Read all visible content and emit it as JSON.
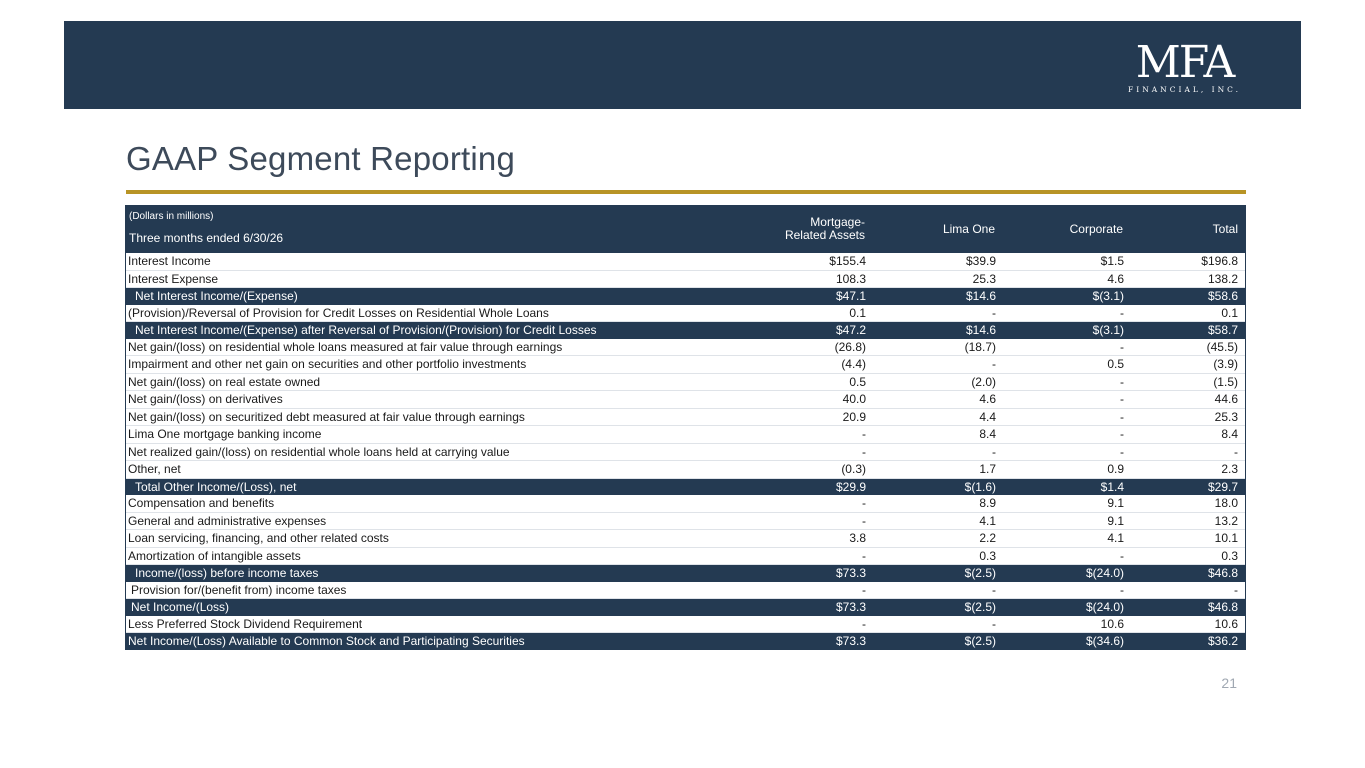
{
  "header": {
    "logo_mark": "MFA",
    "logo_sub": "FINANCIAL, INC."
  },
  "page": {
    "title": "GAAP Segment Reporting",
    "page_number": "21"
  },
  "table": {
    "units_note": "(Dollars in millions)",
    "period": "Three months ended 6/30/26",
    "columns": [
      "Mortgage-\nRelated Assets",
      "Lima One",
      "Corporate",
      "Total"
    ],
    "rows": [
      {
        "label": "Interest Income",
        "values": [
          "$155.4",
          "$39.9",
          "$1.5",
          "$196.8"
        ],
        "type": "row"
      },
      {
        "label": "Interest Expense",
        "values": [
          "108.3",
          "25.3",
          "4.6",
          "138.2"
        ],
        "type": "row"
      },
      {
        "label": "Net Interest Income/(Expense)",
        "values": [
          "$47.1",
          "$14.6",
          "$(3.1)",
          "$58.6"
        ],
        "type": "sub"
      },
      {
        "label": "(Provision)/Reversal of Provision for Credit Losses on Residential Whole Loans",
        "values": [
          "0.1",
          "-",
          "-",
          "0.1"
        ],
        "type": "row"
      },
      {
        "label": "Net Interest Income/(Expense) after Reversal of Provision/(Provision) for Credit Losses",
        "values": [
          "$47.2",
          "$14.6",
          "$(3.1)",
          "$58.7"
        ],
        "type": "sub"
      },
      {
        "label": "Net gain/(loss) on residential whole loans measured at fair value through earnings",
        "values": [
          "(26.8)",
          "(18.7)",
          "-",
          "(45.5)"
        ],
        "type": "row"
      },
      {
        "label": "Impairment and other net gain on securities and other portfolio investments",
        "values": [
          "(4.4)",
          "-",
          "0.5",
          "(3.9)"
        ],
        "type": "row"
      },
      {
        "label": "Net gain/(loss) on real estate owned",
        "values": [
          "0.5",
          "(2.0)",
          "-",
          "(1.5)"
        ],
        "type": "row"
      },
      {
        "label": "Net gain/(loss) on derivatives",
        "values": [
          "40.0",
          "4.6",
          "-",
          "44.6"
        ],
        "type": "row"
      },
      {
        "label": "Net gain/(loss) on securitized debt measured at fair value through earnings",
        "values": [
          "20.9",
          "4.4",
          "-",
          "25.3"
        ],
        "type": "row"
      },
      {
        "label": "Lima One mortgage banking income",
        "values": [
          "-",
          "8.4",
          "-",
          "8.4"
        ],
        "type": "row"
      },
      {
        "label": "Net realized gain/(loss) on residential whole loans held at carrying value",
        "values": [
          "-",
          "-",
          "-",
          "-"
        ],
        "type": "row"
      },
      {
        "label": "Other, net",
        "values": [
          "(0.3)",
          "1.7",
          "0.9",
          "2.3"
        ],
        "type": "row"
      },
      {
        "label": "Total Other Income/(Loss), net",
        "values": [
          "$29.9",
          "$(1.6)",
          "$1.4",
          "$29.7"
        ],
        "type": "sub"
      },
      {
        "label": "Compensation and benefits",
        "values": [
          "-",
          "8.9",
          "9.1",
          "18.0"
        ],
        "type": "row"
      },
      {
        "label": "General and administrative expenses",
        "values": [
          "-",
          "4.1",
          "9.1",
          "13.2"
        ],
        "type": "row"
      },
      {
        "label": "Loan servicing, financing, and other related costs",
        "values": [
          "3.8",
          "2.2",
          "4.1",
          "10.1"
        ],
        "type": "row"
      },
      {
        "label": "Amortization of intangible assets",
        "values": [
          "-",
          "0.3",
          "-",
          "0.3"
        ],
        "type": "row"
      },
      {
        "label": "Income/(loss) before income taxes",
        "values": [
          "$73.3",
          "$(2.5)",
          "$(24.0)",
          "$46.8"
        ],
        "type": "sub"
      },
      {
        "label": "Provision for/(benefit from) income taxes",
        "values": [
          "-",
          "-",
          "-",
          "-"
        ],
        "type": "row ind1"
      },
      {
        "label": "Net Income/(Loss)",
        "values": [
          "$73.3",
          "$(2.5)",
          "$(24.0)",
          "$46.8"
        ],
        "type": "sub ind1"
      },
      {
        "label": "Less Preferred Stock Dividend Requirement",
        "values": [
          "-",
          "-",
          "10.6",
          "10.6"
        ],
        "type": "row"
      },
      {
        "label": "Net Income/(Loss) Available to Common Stock and Participating Securities",
        "values": [
          "$73.3",
          "$(2.5)",
          "$(34.6)",
          "$36.2"
        ],
        "type": "sub flush"
      }
    ]
  },
  "colors": {
    "navy": "#243a52",
    "gold_rule": "#b89425",
    "title_text": "#3d4a5a"
  }
}
